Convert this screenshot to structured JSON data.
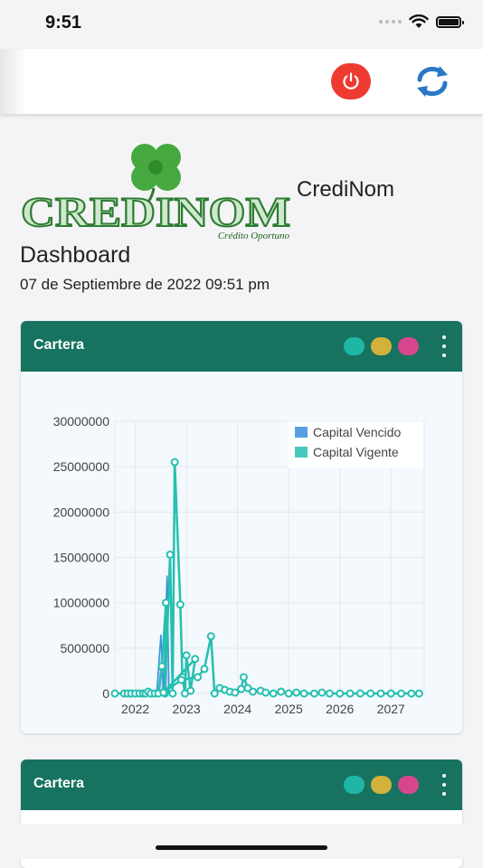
{
  "status_bar": {
    "time": "9:51"
  },
  "header": {
    "power_icon": "power-icon",
    "refresh_icon": "refresh-icon",
    "power_color": "#ee3b32"
  },
  "brand": {
    "logo_text": "CREDINOM",
    "logo_tagline": "Crédito Oportuno",
    "app_name": "CrediNom"
  },
  "page": {
    "title": "Dashboard",
    "date": "07 de Septiembre de 2022 09:51 pm"
  },
  "cards": [
    {
      "title": "Cartera",
      "dot_colors": [
        "#1fb6a6",
        "#d4b13a",
        "#d8458f"
      ]
    },
    {
      "title": "Cartera",
      "dot_colors": [
        "#1fb6a6",
        "#d4b13a",
        "#d8458f"
      ]
    }
  ],
  "chart_data": {
    "type": "line",
    "title": "",
    "xlabel": "",
    "ylabel": "",
    "x_ticks": [
      "2022",
      "2023",
      "2024",
      "2025",
      "2026",
      "2027"
    ],
    "y_ticks": [
      0,
      5000000,
      10000000,
      15000000,
      20000000,
      25000000,
      30000000
    ],
    "y_tick_labels": [
      "0",
      "5000000",
      "10000000",
      "15000000",
      "20000000",
      "25000000",
      "30000000"
    ],
    "ylim": [
      0,
      30000000
    ],
    "xlim": [
      2021.6,
      2027.65
    ],
    "legend_position": "top-right",
    "grid": true,
    "series": [
      {
        "name": "Capital Vencido",
        "color": "#3b8fdd",
        "points": [
          [
            2022.2,
            0
          ],
          [
            2022.3,
            0
          ],
          [
            2022.42,
            200000
          ],
          [
            2022.5,
            6500000
          ],
          [
            2022.55,
            0
          ],
          [
            2022.62,
            13000000
          ],
          [
            2022.66,
            0
          ],
          [
            2022.72,
            0
          ]
        ]
      },
      {
        "name": "Capital Vigente",
        "color": "#26bfb0",
        "points": [
          [
            2021.6,
            0
          ],
          [
            2021.78,
            0
          ],
          [
            2021.85,
            0
          ],
          [
            2021.92,
            0
          ],
          [
            2022.0,
            0
          ],
          [
            2022.08,
            0
          ],
          [
            2022.15,
            0
          ],
          [
            2022.2,
            0
          ],
          [
            2022.25,
            200000
          ],
          [
            2022.3,
            0
          ],
          [
            2022.38,
            0
          ],
          [
            2022.45,
            0
          ],
          [
            2022.52,
            3000000
          ],
          [
            2022.6,
            10000000
          ],
          [
            2022.58,
            0
          ],
          [
            2022.68,
            15300000
          ],
          [
            2022.73,
            0
          ],
          [
            2022.77,
            25500000
          ],
          [
            2022.88,
            9800000
          ],
          [
            2022.92,
            1800000
          ],
          [
            2022.97,
            0
          ],
          [
            2023.0,
            4200000
          ],
          [
            2023.08,
            300000
          ],
          [
            2023.17,
            3800000
          ],
          [
            2022.55,
            100000
          ],
          [
            2022.9,
            1500000
          ],
          [
            2023.22,
            1800000
          ],
          [
            2023.35,
            2700000
          ],
          [
            2023.48,
            6300000
          ],
          [
            2023.55,
            0
          ],
          [
            2023.65,
            600000
          ],
          [
            2023.75,
            400000
          ],
          [
            2023.85,
            200000
          ],
          [
            2023.95,
            100000
          ],
          [
            2024.07,
            500000
          ],
          [
            2024.12,
            1800000
          ],
          [
            2024.2,
            600000
          ],
          [
            2024.3,
            200000
          ],
          [
            2024.45,
            300000
          ],
          [
            2024.55,
            100000
          ],
          [
            2024.7,
            0
          ],
          [
            2024.85,
            200000
          ],
          [
            2025.0,
            0
          ],
          [
            2025.15,
            100000
          ],
          [
            2025.3,
            0
          ],
          [
            2025.5,
            0
          ],
          [
            2025.65,
            100000
          ],
          [
            2025.8,
            0
          ],
          [
            2026.0,
            0
          ],
          [
            2026.2,
            0
          ],
          [
            2026.4,
            0
          ],
          [
            2026.6,
            0
          ],
          [
            2026.8,
            0
          ],
          [
            2027.0,
            0
          ],
          [
            2027.2,
            0
          ],
          [
            2027.4,
            0
          ],
          [
            2027.55,
            0
          ]
        ]
      }
    ]
  }
}
